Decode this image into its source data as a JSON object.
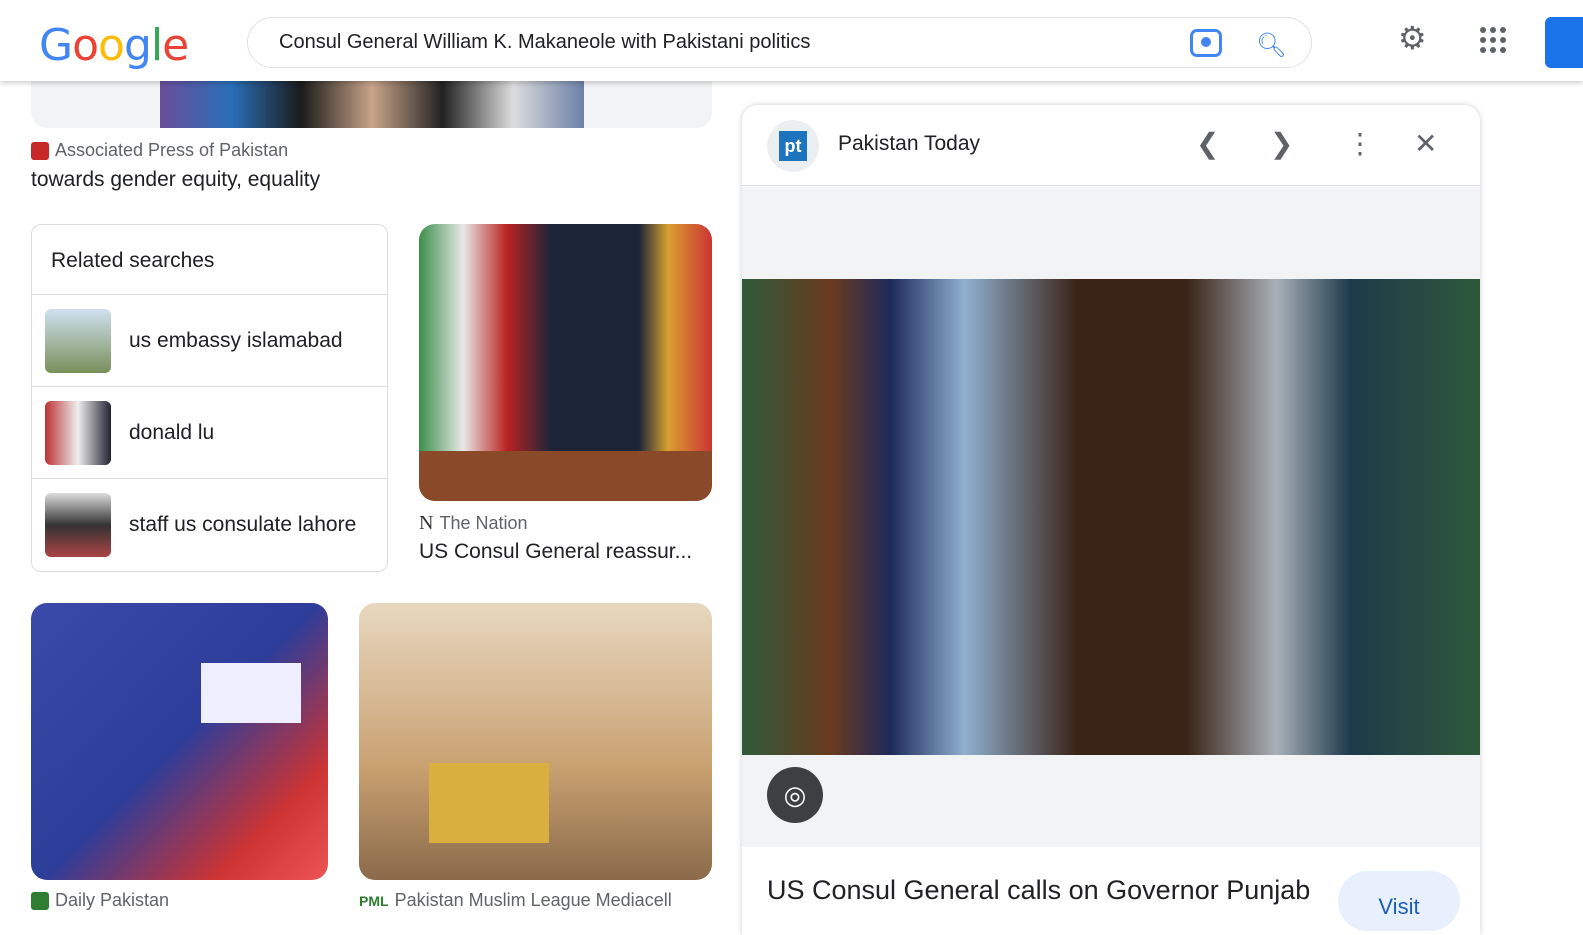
{
  "header": {
    "logo": "Google",
    "query": "Consul General William K. Makaneole with Pakistani politics",
    "icons": [
      "camera-icon",
      "search-icon",
      "gear-icon",
      "apps-grid-icon"
    ]
  },
  "results": [
    {
      "source": "Associated Press of Pakistan",
      "title": "towards gender equity, equality"
    },
    {
      "source": "The Nation",
      "title": "US Consul General reassur..."
    },
    {
      "source": "Daily Pakistan",
      "title": ""
    },
    {
      "source": "Pakistan Muslim League Mediacell",
      "title": ""
    }
  ],
  "related": {
    "heading": "Related searches",
    "items": [
      {
        "label": "us embassy islamabad"
      },
      {
        "label": "donald lu"
      },
      {
        "label": "staff us consulate lahore"
      }
    ]
  },
  "panel": {
    "source": "Pakistan Today",
    "logo_text": "pt",
    "title": "US Consul General calls on Governor Punjab",
    "visit": "Visit"
  }
}
